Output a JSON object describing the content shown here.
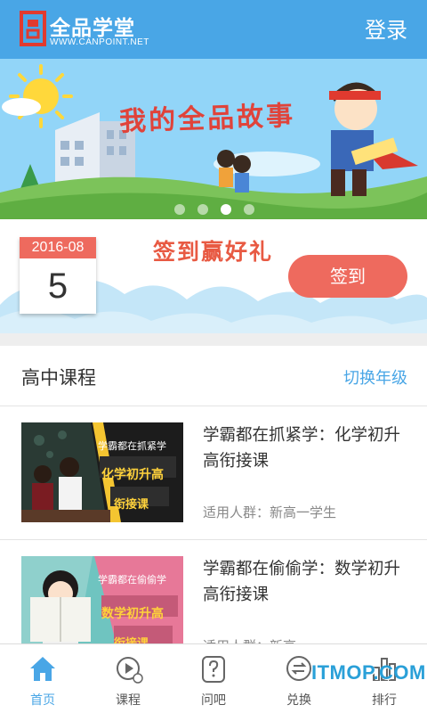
{
  "header": {
    "logo_name": "全品学堂",
    "logo_url": "WWW.CANPOINT.NET",
    "login_label": "登录"
  },
  "banner": {
    "title": "我的全品故事",
    "slide_count": 4,
    "active_slide": 3
  },
  "signin": {
    "month": "2016-08",
    "day": "5",
    "slogan": "签到赢好礼",
    "button_label": "签到"
  },
  "courses": {
    "section_title": "高中课程",
    "switch_label": "切换年级",
    "items": [
      {
        "title": "学霸都在抓紧学：化学初升高衔接课",
        "audience": "适用人群：新高一学生",
        "thumb_line1": "学霸都在抓紧学",
        "thumb_line2": "化学初升高",
        "thumb_line3": "衔接课"
      },
      {
        "title": "学霸都在偷偷学：数学初升高衔接课",
        "audience": "适用人群：新高一",
        "thumb_line1": "学霸都在偷偷学",
        "thumb_line2": "数学初升高",
        "thumb_line3": "衔接课"
      }
    ]
  },
  "tabs": [
    {
      "label": "首页",
      "icon": "home-icon",
      "active": true
    },
    {
      "label": "课程",
      "icon": "play-icon",
      "active": false
    },
    {
      "label": "问吧",
      "icon": "question-icon",
      "active": false
    },
    {
      "label": "兑换",
      "icon": "exchange-icon",
      "active": false
    },
    {
      "label": "排行",
      "icon": "ranking-icon",
      "active": false
    }
  ],
  "watermark": "ITMOP.COM",
  "colors": {
    "primary": "#49a6e6",
    "accent": "#ee6a5e"
  }
}
